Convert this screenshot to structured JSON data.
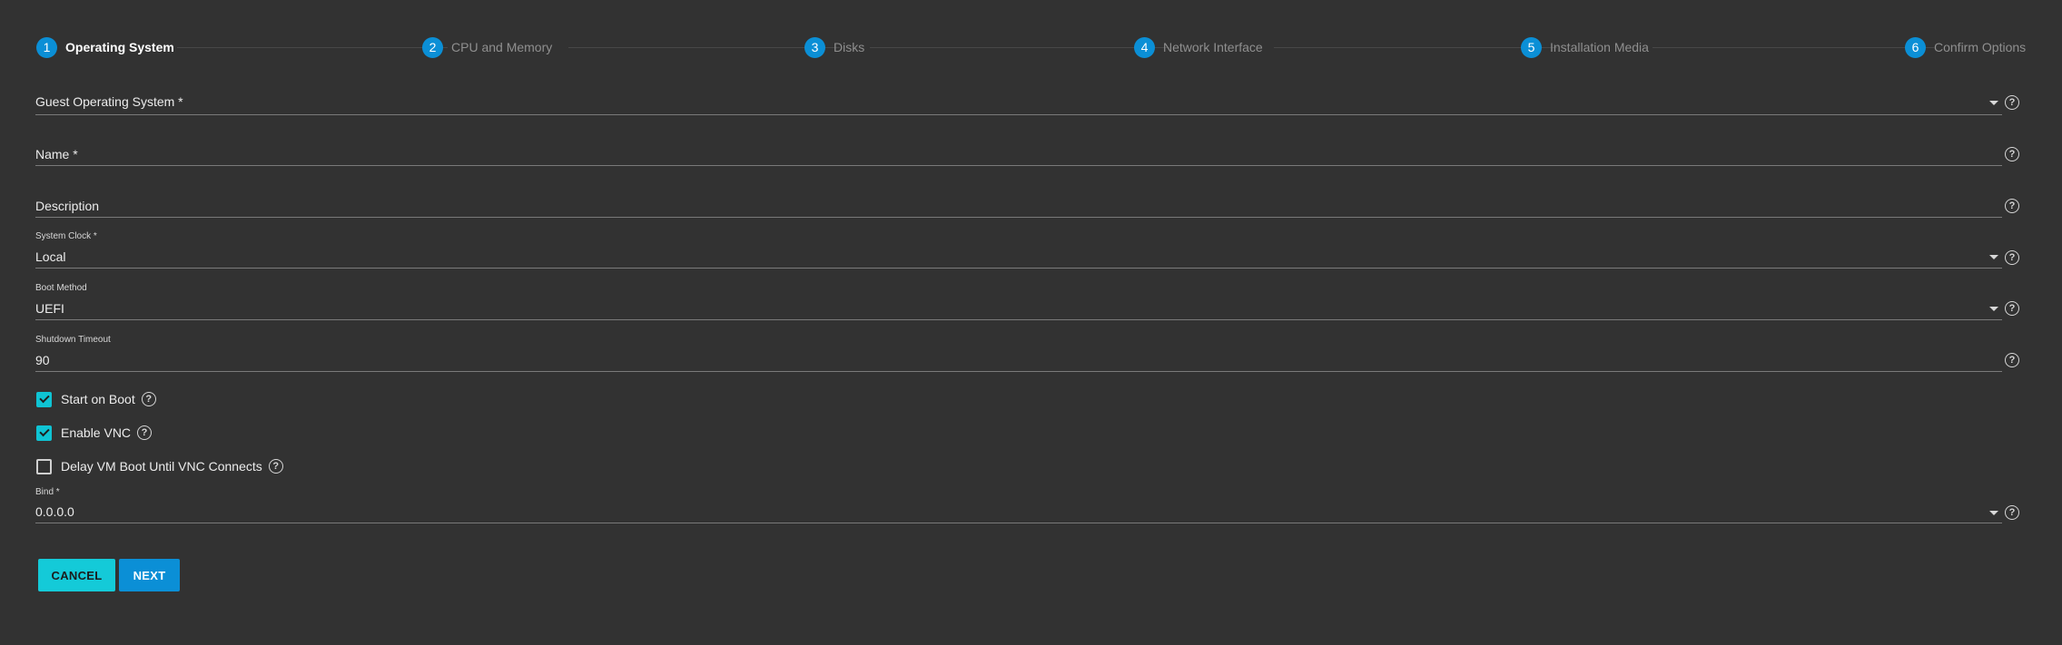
{
  "stepper": {
    "steps": [
      {
        "number": "1",
        "label": "Operating System",
        "active": true
      },
      {
        "number": "2",
        "label": "CPU and Memory",
        "active": false
      },
      {
        "number": "3",
        "label": "Disks",
        "active": false
      },
      {
        "number": "4",
        "label": "Network Interface",
        "active": false
      },
      {
        "number": "5",
        "label": "Installation Media",
        "active": false
      },
      {
        "number": "6",
        "label": "Confirm Options",
        "active": false
      }
    ]
  },
  "form": {
    "guest_os": {
      "label": "Guest Operating System *",
      "value": ""
    },
    "name": {
      "label": "Name *",
      "value": ""
    },
    "description": {
      "label": "Description",
      "value": ""
    },
    "system_clock": {
      "label": "System Clock *",
      "value": "Local"
    },
    "boot_method": {
      "label": "Boot Method",
      "value": "UEFI"
    },
    "shutdown_timeout": {
      "label": "Shutdown Timeout",
      "value": "90"
    },
    "start_on_boot": {
      "label": "Start on Boot",
      "checked": true
    },
    "enable_vnc": {
      "label": "Enable VNC",
      "checked": true
    },
    "delay_vm_boot": {
      "label": "Delay VM Boot Until VNC Connects",
      "checked": false
    },
    "bind": {
      "label": "Bind *",
      "value": "0.0.0.0"
    }
  },
  "actions": {
    "cancel_label": "CANCEL",
    "next_label": "NEXT"
  },
  "help_glyph": "?",
  "icons": {
    "help": "help-circle-icon",
    "dropdown": "caret-down-icon",
    "check": "check-icon"
  },
  "colors": {
    "background": "#323232",
    "step_accent": "#0b8fd6",
    "checkbox_accent": "#0fc4d4",
    "cancel_button": "#14cad8",
    "next_button": "#0b8fd6"
  }
}
